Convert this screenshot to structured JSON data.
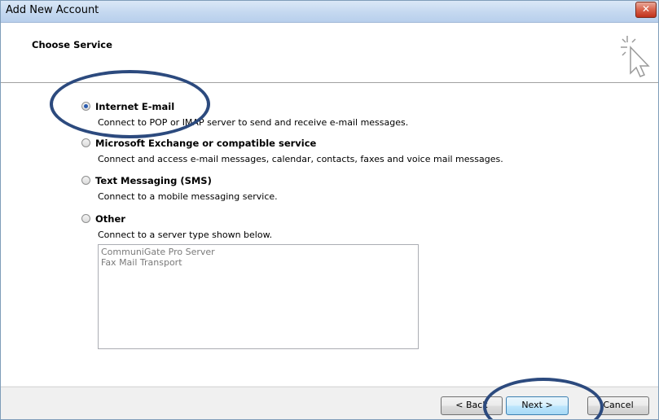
{
  "window": {
    "title": "Add New Account",
    "close_glyph": "✕"
  },
  "header": {
    "title": "Choose Service"
  },
  "options": [
    {
      "label": "Internet E-mail",
      "description": "Connect to POP or IMAP server to send and receive e-mail messages.",
      "selected": true
    },
    {
      "label": "Microsoft Exchange or compatible service",
      "description": "Connect and access e-mail messages, calendar, contacts, faxes and voice mail messages.",
      "selected": false
    },
    {
      "label": "Text Messaging (SMS)",
      "description": "Connect to a mobile messaging service.",
      "selected": false
    },
    {
      "label": "Other",
      "description": "Connect to a server type shown below.",
      "selected": false
    }
  ],
  "server_types": [
    "CommuniGate Pro Server",
    "Fax Mail Transport"
  ],
  "buttons": {
    "back": "< Back",
    "next": "Next >",
    "cancel": "Cancel"
  },
  "colors": {
    "annotation_ellipse": "#2c4a7e",
    "selected_radio": "#2a5cb0"
  }
}
